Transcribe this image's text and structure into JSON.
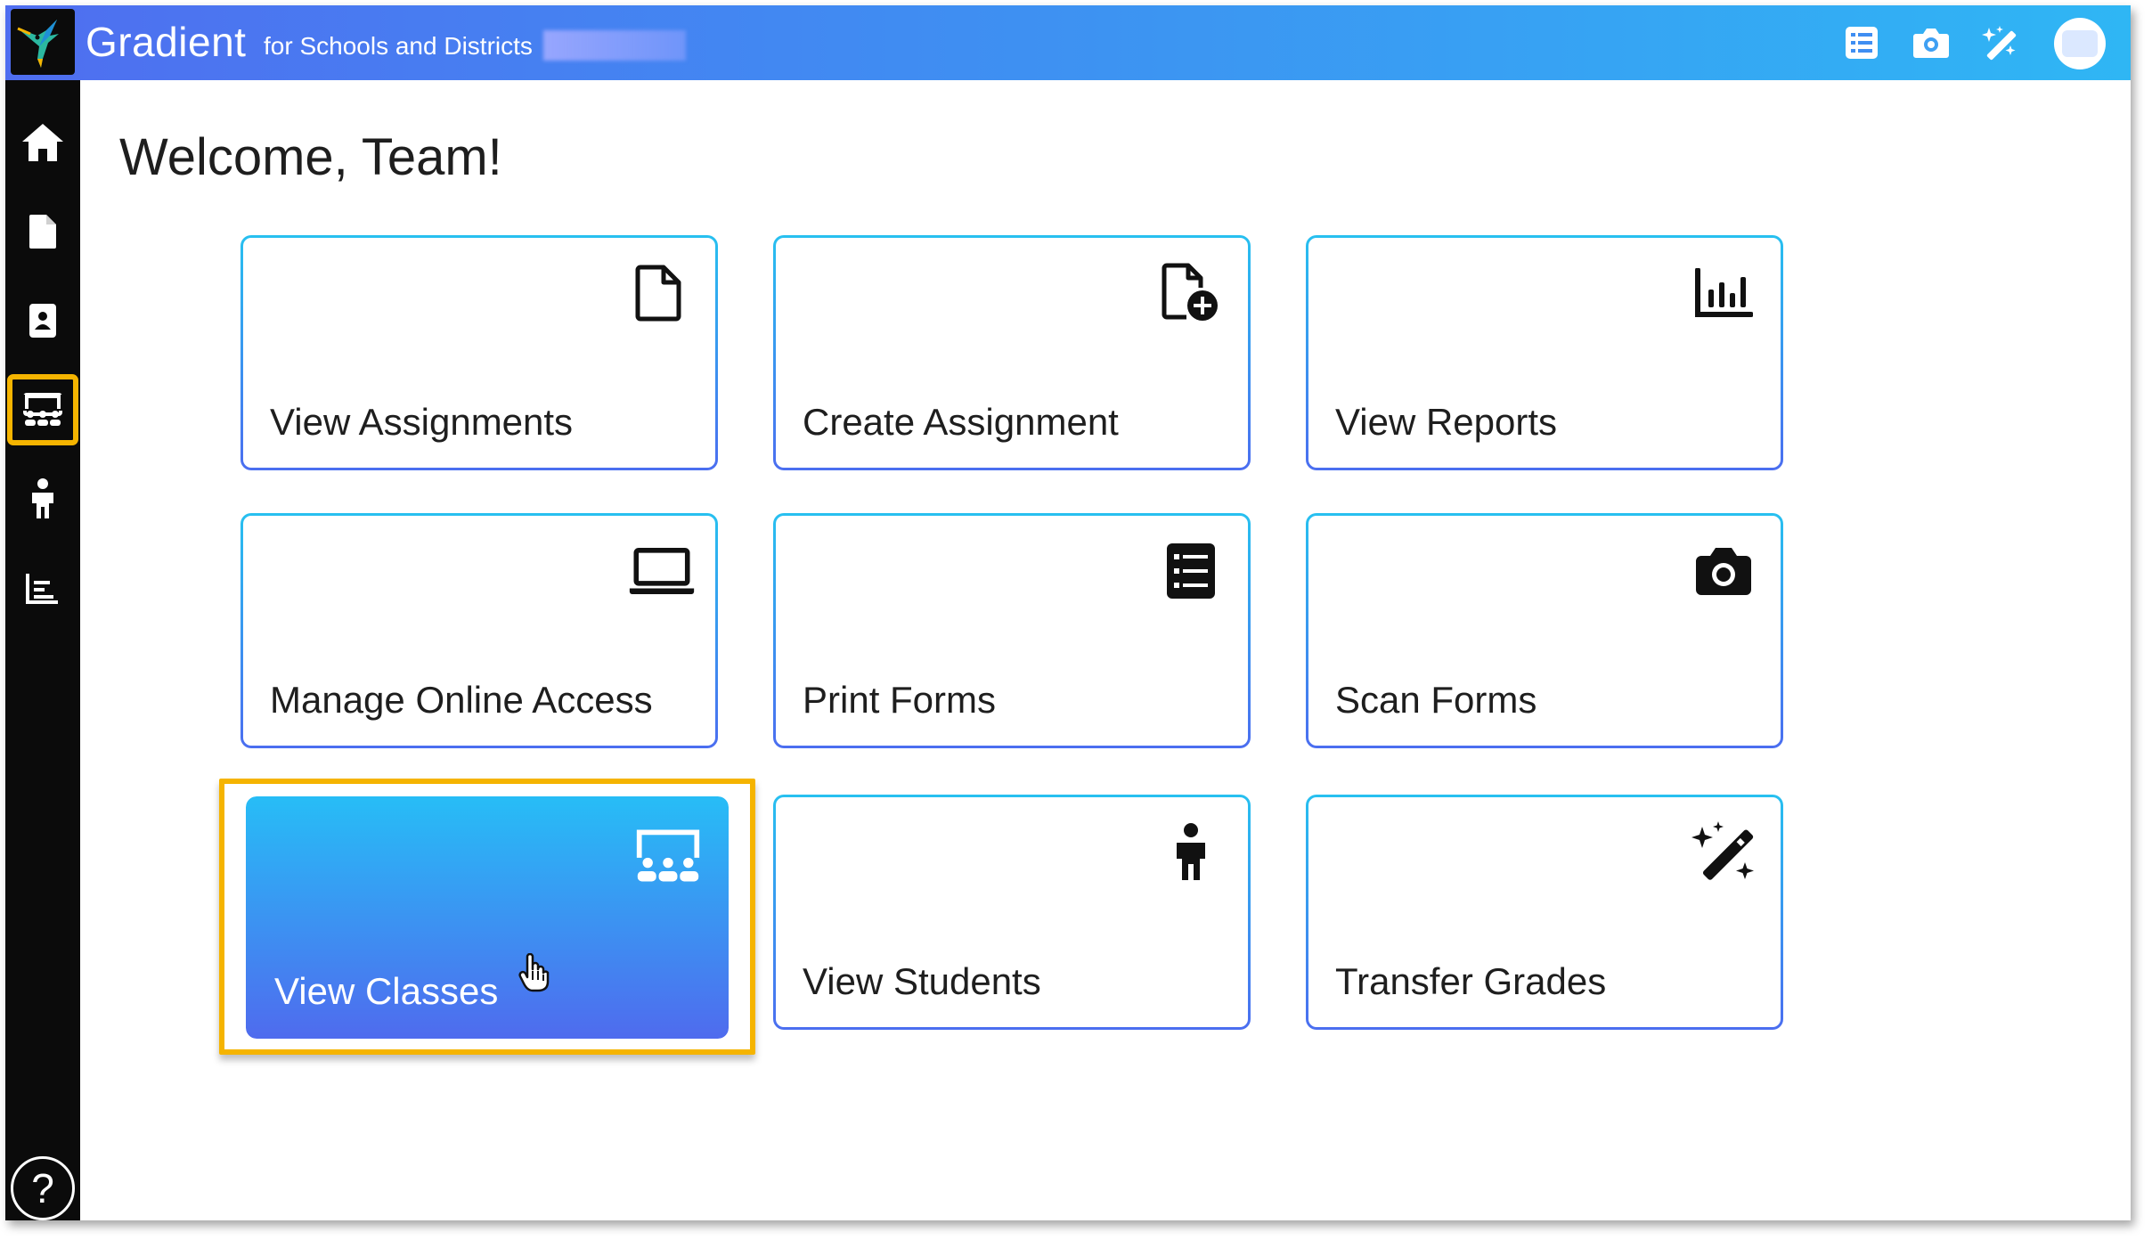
{
  "header": {
    "brand": "Gradient",
    "subtitle": "for Schools and Districts",
    "icons": [
      "list-icon",
      "camera-icon",
      "magic-wand-icon"
    ]
  },
  "sidebar": {
    "items": [
      "home-icon",
      "document-icon",
      "contact-card-icon",
      "classes-icon",
      "student-icon",
      "reports-icon"
    ],
    "active": "classes-icon",
    "help_label": "?"
  },
  "main": {
    "welcome": "Welcome, Team!",
    "cards": [
      {
        "label": "View Assignments",
        "icon": "document-icon"
      },
      {
        "label": "Create Assignment",
        "icon": "document-add-icon"
      },
      {
        "label": "View Reports",
        "icon": "chart-icon"
      },
      {
        "label": "Manage Online Access",
        "icon": "laptop-icon"
      },
      {
        "label": "Print Forms",
        "icon": "list-icon"
      },
      {
        "label": "Scan Forms",
        "icon": "camera-icon"
      },
      {
        "label": "View Classes",
        "icon": "classes-icon"
      },
      {
        "label": "View Students",
        "icon": "student-icon"
      },
      {
        "label": "Transfer Grades",
        "icon": "magic-wand-icon"
      }
    ],
    "active_card": "View Classes"
  },
  "colors": {
    "header_start": "#4f6ef0",
    "header_end": "#2fb6f4",
    "sidebar": "#0b0b0b",
    "highlight": "#f5b400",
    "card_border_top": "#27c0f0",
    "card_border_bottom": "#4b6ef0"
  }
}
